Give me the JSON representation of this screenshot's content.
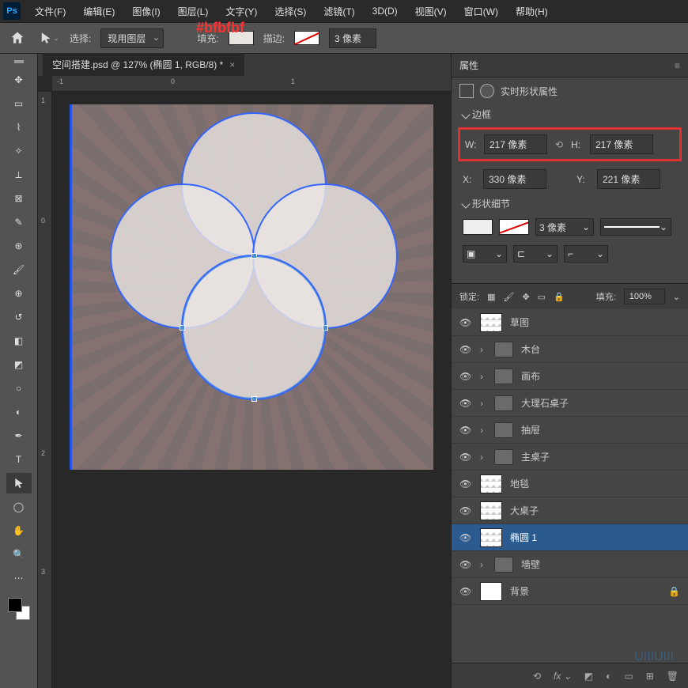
{
  "annotation_hex": "#bfbfbf",
  "menu": {
    "file": "文件(F)",
    "edit": "编辑(E)",
    "image": "图像(I)",
    "layer": "图层(L)",
    "text": "文字(Y)",
    "select": "选择(S)",
    "filter": "滤镜(T)",
    "threeD": "3D(D)",
    "view": "视图(V)",
    "window": "窗口(W)",
    "help": "帮助(H)"
  },
  "options": {
    "select_label": "选择:",
    "select_value": "现用图层",
    "fill_label": "填充:",
    "stroke_label": "描边:",
    "stroke_size": "3 像素"
  },
  "tab": {
    "title": "空间搭建.psd @ 127% (椭圆 1, RGB/8) *",
    "close": "×"
  },
  "rulers_h": {
    "n1": "-1",
    "z": "0",
    "p1": "1"
  },
  "rulers_v": {
    "r1": "1",
    "r0": "0",
    "r2": "2",
    "r3": "3"
  },
  "properties": {
    "panel_title": "属性",
    "header": "实时形状属性",
    "border_section": "边框",
    "w_label": "W:",
    "w_value": "217 像素",
    "h_label": "H:",
    "h_value": "217 像素",
    "x_label": "X:",
    "x_value": "330 像素",
    "y_label": "Y:",
    "y_value": "221 像素",
    "shape_section": "形状细节",
    "stroke_val": "3 像素"
  },
  "layers": {
    "lock_label": "锁定:",
    "fill_label": "填充:",
    "fill_value": "100%",
    "items": [
      {
        "name": "草图",
        "type": "thumb"
      },
      {
        "name": "木台",
        "type": "folder"
      },
      {
        "name": "画布",
        "type": "folder"
      },
      {
        "name": "大理石桌子",
        "type": "folder"
      },
      {
        "name": "抽屉",
        "type": "folder"
      },
      {
        "name": "主桌子",
        "type": "folder"
      },
      {
        "name": "地毯",
        "type": "thumb"
      },
      {
        "name": "大桌子",
        "type": "thumb"
      },
      {
        "name": "椭圆 1",
        "type": "thumb",
        "active": true
      },
      {
        "name": "墙壁",
        "type": "folder"
      },
      {
        "name": "背景",
        "type": "white",
        "locked": true
      }
    ]
  },
  "watermark": "UIIIUIII"
}
